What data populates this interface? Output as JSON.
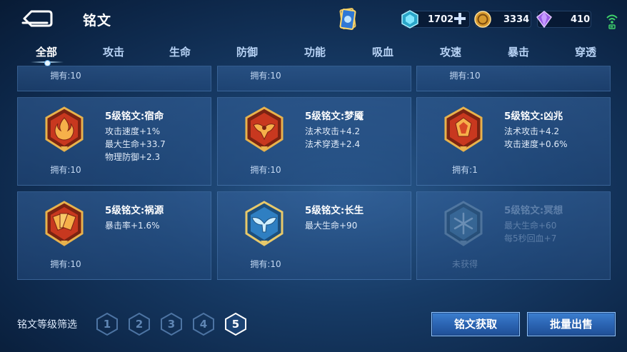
{
  "header": {
    "title": "铭文",
    "resources": [
      {
        "name": "diamond",
        "value": "1702"
      },
      {
        "name": "gold",
        "value": "3334"
      },
      {
        "name": "crystal",
        "value": "410"
      }
    ]
  },
  "tabs": [
    "全部",
    "攻击",
    "生命",
    "防御",
    "功能",
    "吸血",
    "攻速",
    "暴击",
    "穿透"
  ],
  "top_row": [
    {
      "owned": "拥有:10"
    },
    {
      "owned": "拥有:10"
    },
    {
      "owned": "拥有:10"
    }
  ],
  "runes": [
    {
      "name": "5级铭文:宿命",
      "stats": [
        "攻击速度+1%",
        "最大生命+33.7",
        "物理防御+2.3"
      ],
      "owned": "拥有:10",
      "theme": "#c8381f",
      "icon": "flame-emblem-icon"
    },
    {
      "name": "5级铭文:梦魇",
      "stats": [
        "法术攻击+4.2",
        "法术穿透+2.4"
      ],
      "owned": "拥有:10",
      "theme": "#c8381f",
      "icon": "spider-emblem-icon"
    },
    {
      "name": "5级铭文:凶兆",
      "stats": [
        "法术攻击+4.2",
        "攻击速度+0.6%"
      ],
      "owned": "拥有:1",
      "theme": "#c8381f",
      "icon": "gem-emblem-icon"
    },
    {
      "name": "5级铭文:祸源",
      "stats": [
        "暴击率+1.6%"
      ],
      "owned": "拥有:10",
      "theme": "#c8381f",
      "icon": "cards-emblem-icon"
    },
    {
      "name": "5级铭文:长生",
      "stats": [
        "最大生命+90"
      ],
      "owned": "拥有:10",
      "theme": "#2f7fc2",
      "icon": "whale-tail-emblem-icon"
    },
    {
      "name": "5级铭文:冥想",
      "stats": [
        "最大生命+60",
        "每5秒回血+7"
      ],
      "owned": "未获得",
      "theme": "#4a7fa8",
      "icon": "snowflake-emblem-icon"
    }
  ],
  "filter": {
    "label": "铭文等级筛选",
    "levels": [
      "1",
      "2",
      "3",
      "4",
      "5"
    ],
    "selected": "5"
  },
  "buttons": {
    "acquire": "铭文获取",
    "sell": "批量出售"
  }
}
